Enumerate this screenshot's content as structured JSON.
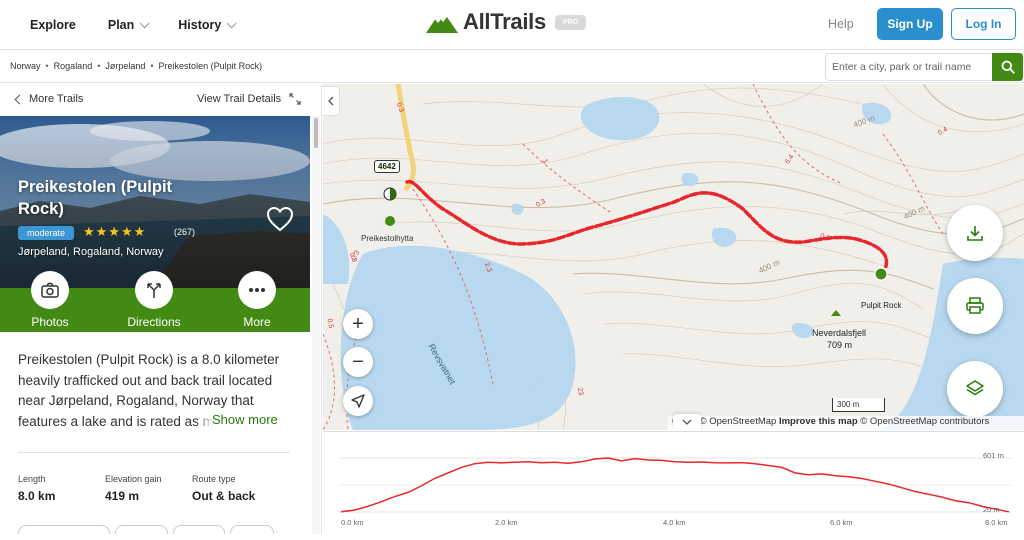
{
  "nav": {
    "items": [
      {
        "label": "Explore"
      },
      {
        "label": "Plan"
      },
      {
        "label": "History"
      }
    ],
    "logo_text": "AllTrails",
    "pro_badge": "PRO",
    "help": "Help",
    "signup": "Sign Up",
    "login": "Log In"
  },
  "breadcrumb": {
    "items": [
      "Norway",
      "Rogaland",
      "Jørpeland",
      "Preikestolen (Pulpit Rock)"
    ],
    "separator": "•"
  },
  "search": {
    "placeholder": "Enter a city, park or trail name"
  },
  "panel": {
    "more_trails": "More Trails",
    "view_details": "View Trail Details",
    "title": "Preikestolen (Pulpit Rock)",
    "difficulty": "moderate",
    "stars": "★★★★★",
    "rating": 5,
    "rating_count": "(267)",
    "location": "Jørpeland, Rogaland, Norway",
    "actions": [
      {
        "label": "Photos"
      },
      {
        "label": "Directions"
      },
      {
        "label": "More"
      }
    ],
    "description": "Preikestolen (Pulpit Rock) is a 8.0 kilometer heavily trafficked out and back trail located near Jørpeland, Rogaland, Norway that features a lake and is rated as moderate.",
    "show_more": "Show more",
    "stats": [
      {
        "label": "Length",
        "value": "8.0 km"
      },
      {
        "label": "Elevation gain",
        "value": "419 m"
      },
      {
        "label": "Route type",
        "value": "Out & back"
      }
    ]
  },
  "map": {
    "road_number": "4642",
    "labels": {
      "trailhead": "Preikestolhytta",
      "pulpit": "Pulpit Rock",
      "peak": "Neverdalsfjell",
      "peak_elev": "709 m",
      "lake": "Revsvatnet",
      "c400a": "400 m",
      "c400b": "400 m",
      "c400c": "400 m"
    },
    "trail_distances": [
      "0.3",
      "0.3",
      "0.3",
      "0.3",
      "2.3",
      "0.4",
      "1",
      "6.4",
      "0.3",
      "0.5",
      "23"
    ],
    "scale": "300 m",
    "attribution_prefix": "© ",
    "attribution_mapbox": "box",
    "attribution_osm": "© OpenStreetMap",
    "attribution_improve": "Improve this map",
    "attribution_osm2": "© OpenStreetMap contributors",
    "controls": {
      "zoom_in": "+",
      "zoom_out": "−"
    }
  },
  "elevation": {
    "y_max_label": "601 m",
    "y_min_label": "20 m",
    "x_labels": [
      "0.0 km",
      "2.0 km",
      "4.0 km",
      "6.0 km",
      "8.0 km"
    ],
    "profile_m": [
      22,
      40,
      80,
      130,
      185,
      230,
      300,
      380,
      440,
      500,
      540,
      555,
      548,
      556,
      560,
      550,
      555,
      545,
      560,
      590,
      601,
      570,
      595,
      580,
      575,
      560,
      555,
      558,
      550,
      548,
      552,
      540,
      520,
      500,
      440,
      420,
      430,
      410,
      400,
      380,
      350,
      320,
      280,
      240,
      210,
      180,
      140,
      120,
      80,
      50,
      22
    ]
  },
  "colors": {
    "brand_green": "#428a13",
    "blue": "#2a8fcf",
    "trail_red": "#e8262d"
  }
}
